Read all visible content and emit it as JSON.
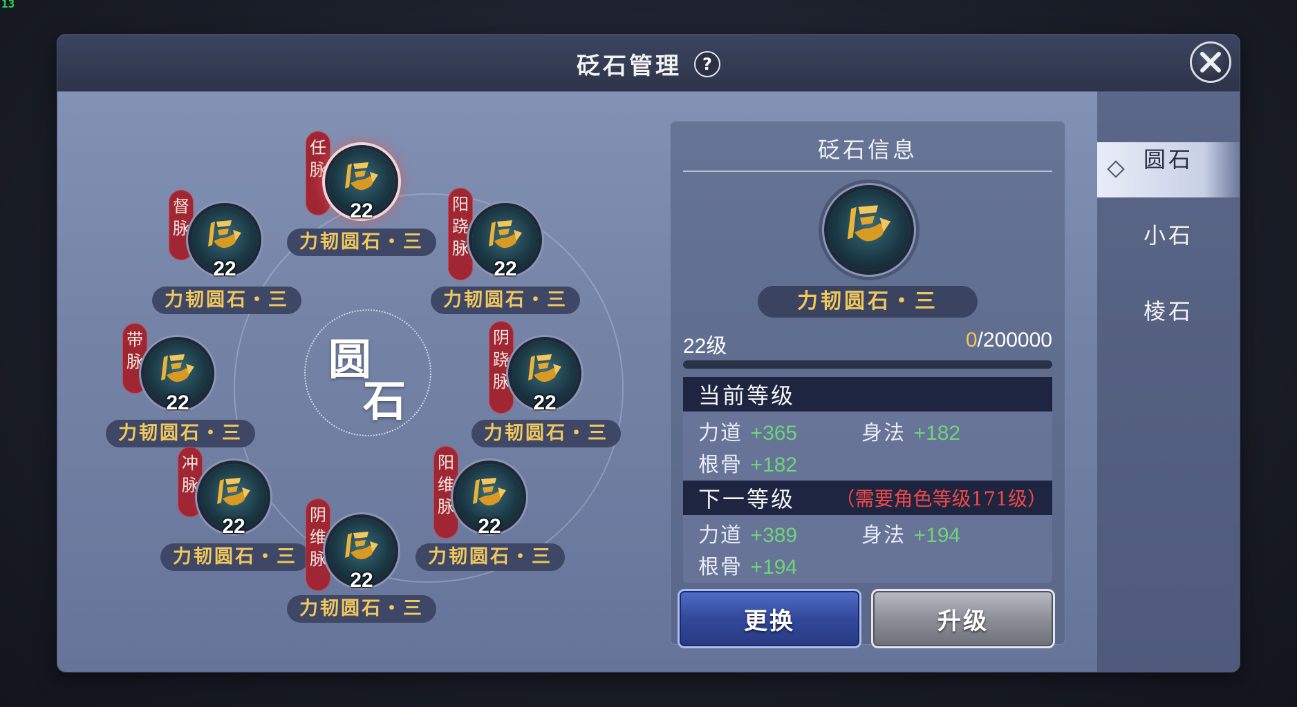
{
  "hud": {
    "fps": "13"
  },
  "dialog": {
    "title": "砭石管理",
    "help_label": "?"
  },
  "wheel": {
    "center_top": "圆",
    "center_bottom": "石",
    "nodes": [
      {
        "meridian": "任脉",
        "level": "22",
        "name": "力韧圆石・三",
        "selected": true
      },
      {
        "meridian": "督脉",
        "level": "22",
        "name": "力韧圆石・三"
      },
      {
        "meridian": "阳跷脉",
        "level": "22",
        "name": "力韧圆石・三"
      },
      {
        "meridian": "带脉",
        "level": "22",
        "name": "力韧圆石・三"
      },
      {
        "meridian": "阴跷脉",
        "level": "22",
        "name": "力韧圆石・三"
      },
      {
        "meridian": "冲脉",
        "level": "22",
        "name": "力韧圆石・三"
      },
      {
        "meridian": "阳维脉",
        "level": "22",
        "name": "力韧圆石・三"
      },
      {
        "meridian": "阴维脉",
        "level": "22",
        "name": "力韧圆石・三"
      }
    ]
  },
  "info": {
    "title": "砭石信息",
    "stone_name": "力韧圆石・三",
    "level_text": "22级",
    "exp_current": "0",
    "exp_total": "/200000",
    "exp_fraction": 0,
    "current": {
      "header": "当前等级",
      "stats": [
        {
          "label": "力道",
          "value": "+365"
        },
        {
          "label": "身法",
          "value": "+182"
        },
        {
          "label": "根骨",
          "value": "+182"
        }
      ]
    },
    "next": {
      "header": "下一等级",
      "requirement": "（需要角色等级171级）",
      "stats": [
        {
          "label": "力道",
          "value": "+389"
        },
        {
          "label": "身法",
          "value": "+194"
        },
        {
          "label": "根骨",
          "value": "+194"
        }
      ]
    },
    "buttons": {
      "swap": "更换",
      "upgrade": "升级"
    }
  },
  "tabs": [
    {
      "label": "圆石",
      "active": true
    },
    {
      "label": "小石"
    },
    {
      "label": "棱石"
    }
  ],
  "colors": {
    "accent_gold": "#f2c75c",
    "stat_green": "#6ed57a",
    "requirement_red": "#f04848",
    "meridian_red": "#a02634"
  }
}
